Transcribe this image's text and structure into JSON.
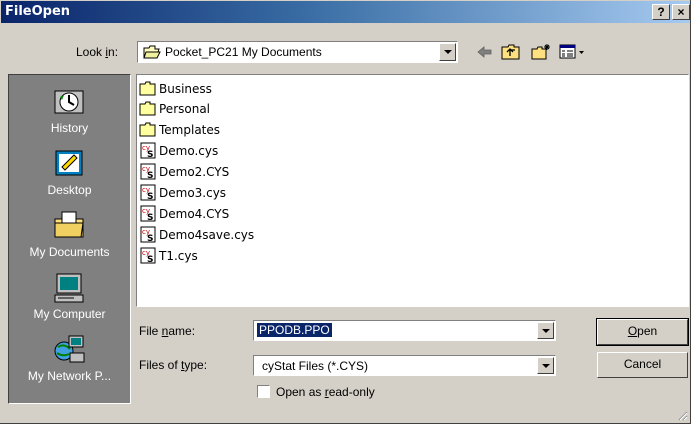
{
  "window": {
    "title": "FileOpen",
    "help_button": "?",
    "close_button": "×"
  },
  "lookin": {
    "label_pre": "Look ",
    "label_u": "i",
    "label_post": "n:",
    "value": "Pocket_PC21 My Documents"
  },
  "places": [
    {
      "label": "History",
      "icon": "history-icon"
    },
    {
      "label": "Desktop",
      "icon": "desktop-icon"
    },
    {
      "label": "My Documents",
      "icon": "my-documents-icon"
    },
    {
      "label": "My Computer",
      "icon": "my-computer-icon"
    },
    {
      "label": "My Network P...",
      "icon": "network-icon"
    }
  ],
  "files": [
    {
      "name": "Business",
      "type": "folder"
    },
    {
      "name": "Personal",
      "type": "folder"
    },
    {
      "name": "Templates",
      "type": "folder"
    },
    {
      "name": "Demo.cys",
      "type": "cys"
    },
    {
      "name": "Demo2.CYS",
      "type": "cys"
    },
    {
      "name": "Demo3.cys",
      "type": "cys"
    },
    {
      "name": "Demo4.CYS",
      "type": "cys"
    },
    {
      "name": "Demo4save.cys",
      "type": "cys"
    },
    {
      "name": "T1.cys",
      "type": "cys"
    }
  ],
  "filename": {
    "label_pre": "File ",
    "label_u": "n",
    "label_post": "ame:",
    "value": "PPODB.PPO"
  },
  "filetype": {
    "label_pre": "Files of ",
    "label_u": "t",
    "label_post": "ype:",
    "value": "cyStat Files (*.CYS)"
  },
  "readonly": {
    "label_pre": "Open as ",
    "label_u": "r",
    "label_post": "ead-only",
    "checked": false
  },
  "buttons": {
    "open_u": "O",
    "open_rest": "pen",
    "cancel": "Cancel"
  }
}
